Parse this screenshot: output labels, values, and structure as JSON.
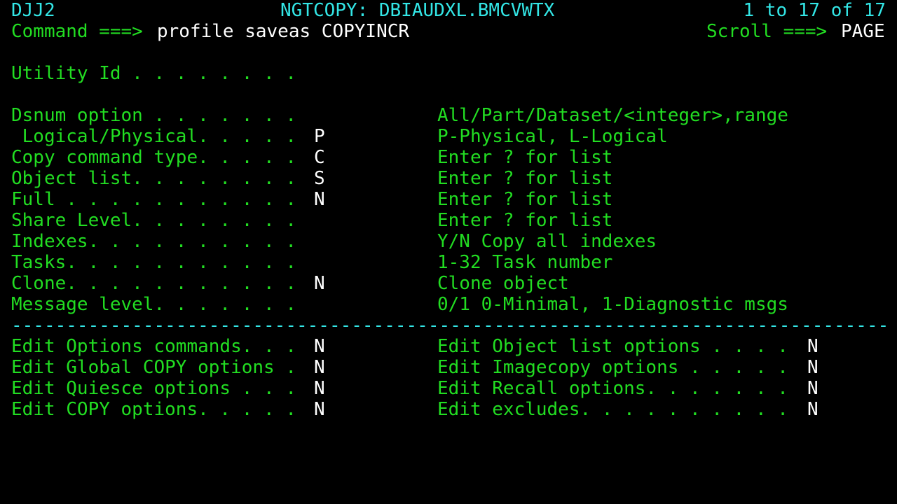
{
  "header": {
    "system_id": "DJJ2",
    "panel_title": "NGTCOPY: DBIAUDXL.BMCVWTX",
    "row_info": "1 to 17 of 17"
  },
  "command_line": {
    "label": "Command ===>",
    "value": "profile saveas COPYINCR",
    "scroll_label": "Scroll ===>",
    "scroll_value": "PAGE"
  },
  "utility_id": {
    "label": "Utility Id . . . . . . . .",
    "value": ""
  },
  "options": [
    {
      "label": "Dsnum option . . . . . . .",
      "value": "",
      "help": "All/Part/Dataset/<integer>,range"
    },
    {
      "label": " Logical/Physical. . . . .",
      "value": "P",
      "help": "P-Physical, L-Logical"
    },
    {
      "label": "Copy command type. . . . .",
      "value": "C",
      "help": "Enter ? for list"
    },
    {
      "label": "Object list. . . . . . . .",
      "value": "S",
      "help": "Enter ? for list"
    },
    {
      "label": "Full . . . . . . . . . . .",
      "value": "N",
      "help": "Enter ? for list"
    },
    {
      "label": "Share Level. . . . . . . .",
      "value": "",
      "help": "Enter ? for list"
    },
    {
      "label": "Indexes. . . . . . . . . .",
      "value": "",
      "help": "Y/N Copy all indexes"
    },
    {
      "label": "Tasks. . . . . . . . . . .",
      "value": "",
      "help": "1-32 Task number"
    },
    {
      "label": "Clone. . . . . . . . . . .",
      "value": "N",
      "help": "Clone object"
    },
    {
      "label": "Message level. . . . . . .",
      "value": "",
      "help": "0/1 0-Minimal, 1-Diagnostic msgs"
    }
  ],
  "separator": "--------------------------------------------------------------------------------",
  "edit_options": {
    "left": [
      {
        "label": "Edit Options commands. . .",
        "value": "N"
      },
      {
        "label": "Edit Global COPY options .",
        "value": "N"
      },
      {
        "label": "Edit Quiesce options . . .",
        "value": "N"
      },
      {
        "label": "Edit COPY options. . . . .",
        "value": "N"
      }
    ],
    "right": [
      {
        "label": "Edit Object list options . . . .",
        "value": "N"
      },
      {
        "label": "Edit Imagecopy options . . . . .",
        "value": "N"
      },
      {
        "label": "Edit Recall options. . . . . . .",
        "value": "N"
      },
      {
        "label": "Edit excludes. . . . . . . . . .",
        "value": "N"
      }
    ]
  },
  "colors": {
    "background": "#000000",
    "label_green": "#22dd22",
    "header_cyan": "#33e6e6",
    "input_white": "#ffffff"
  }
}
